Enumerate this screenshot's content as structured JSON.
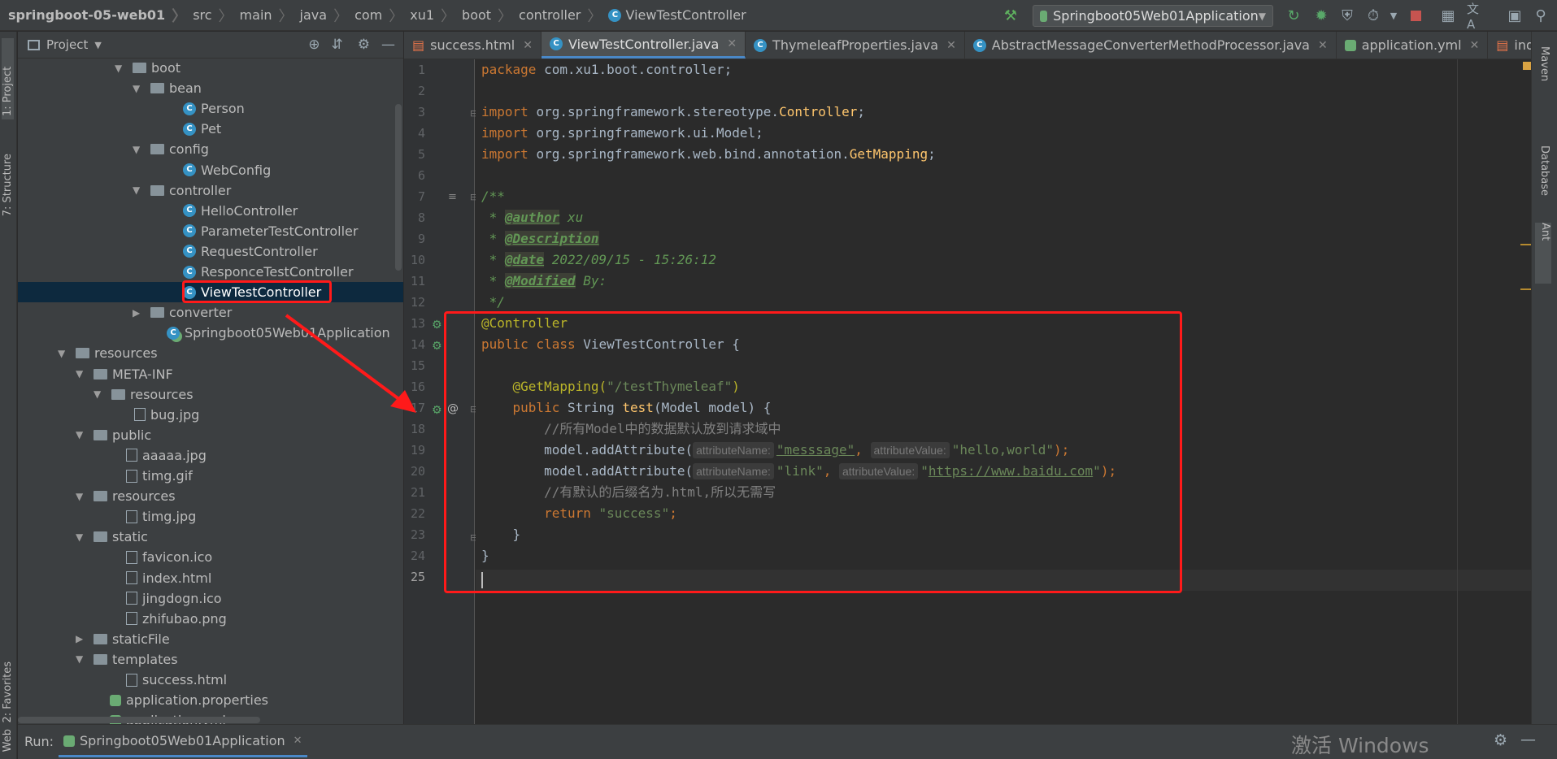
{
  "breadcrumb": [
    "springboot-05-web01",
    "src",
    "main",
    "java",
    "com",
    "xu1",
    "boot",
    "controller",
    "ViewTestController"
  ],
  "toolbar": {
    "run_config": "Springboot05Web01Application"
  },
  "left_strip": {
    "project_label": "1: Project",
    "structure_label": "7: Structure",
    "favorites_label": "2: Favorites",
    "web_label": "Web"
  },
  "project_panel": {
    "title": "Project",
    "tree": [
      {
        "label": "boot",
        "kind": "folder",
        "expanded": true
      },
      {
        "label": "bean",
        "kind": "folder",
        "expanded": true
      },
      {
        "label": "Person",
        "kind": "class"
      },
      {
        "label": "Pet",
        "kind": "class"
      },
      {
        "label": "config",
        "kind": "folder",
        "expanded": true
      },
      {
        "label": "WebConfig",
        "kind": "class"
      },
      {
        "label": "controller",
        "kind": "folder",
        "expanded": true
      },
      {
        "label": "HelloController",
        "kind": "class"
      },
      {
        "label": "ParameterTestController",
        "kind": "class"
      },
      {
        "label": "RequestController",
        "kind": "class"
      },
      {
        "label": "ResponceTestController",
        "kind": "class"
      },
      {
        "label": "ViewTestController",
        "kind": "class",
        "selected": true
      },
      {
        "label": "converter",
        "kind": "folder",
        "expanded": false
      },
      {
        "label": "Springboot05Web01Application",
        "kind": "app"
      },
      {
        "label": "resources",
        "kind": "folder",
        "expanded": true
      },
      {
        "label": "META-INF",
        "kind": "folder",
        "expanded": true
      },
      {
        "label": "resources",
        "kind": "folder",
        "expanded": true
      },
      {
        "label": "bug.jpg",
        "kind": "file"
      },
      {
        "label": "public",
        "kind": "folder",
        "expanded": true
      },
      {
        "label": "aaaaa.jpg",
        "kind": "file"
      },
      {
        "label": "timg.gif",
        "kind": "file"
      },
      {
        "label": "resources",
        "kind": "folder",
        "expanded": true
      },
      {
        "label": "timg.jpg",
        "kind": "file"
      },
      {
        "label": "static",
        "kind": "folder",
        "expanded": true
      },
      {
        "label": "favicon.ico",
        "kind": "file"
      },
      {
        "label": "index.html",
        "kind": "file"
      },
      {
        "label": "jingdogn.ico",
        "kind": "file"
      },
      {
        "label": "zhifubao.png",
        "kind": "file"
      },
      {
        "label": "staticFile",
        "kind": "folder",
        "expanded": false
      },
      {
        "label": "templates",
        "kind": "folder",
        "expanded": true
      },
      {
        "label": "success.html",
        "kind": "file"
      },
      {
        "label": "application.properties",
        "kind": "config"
      },
      {
        "label": "application.yml",
        "kind": "config"
      }
    ]
  },
  "tabs": [
    {
      "label": "success.html",
      "active": false
    },
    {
      "label": "ViewTestController.java",
      "active": true
    },
    {
      "label": "ThymeleafProperties.java",
      "active": false
    },
    {
      "label": "AbstractMessageConverterMethodProcessor.java",
      "active": false
    },
    {
      "label": "application.yml",
      "active": false
    },
    {
      "label": "index.html",
      "active": false
    }
  ],
  "right_strip": {
    "maven_label": "Maven",
    "database_label": "Database",
    "ant_label": "Ant"
  },
  "editor": {
    "line_numbers": [
      "1",
      "2",
      "3",
      "4",
      "5",
      "6",
      "7",
      "8",
      "9",
      "10",
      "11",
      "12",
      "13",
      "14",
      "15",
      "16",
      "17",
      "18",
      "19",
      "20",
      "21",
      "22",
      "23",
      "24",
      "25"
    ],
    "code": {
      "l1_kw": "package ",
      "l1_rest": "com.xu1.boot.controller;",
      "l3_kw": "import ",
      "l3_pkg": "org.springframework.stereotype.",
      "l3_cls": "Controller",
      "l4_kw": "import ",
      "l4_pkg": "org.springframework.ui.Model;",
      "l5_kw": "import ",
      "l5_pkg": "org.springframework.web.bind.annotation.",
      "l5_cls": "GetMapping",
      "semi": ";",
      "l7": "/**",
      "l8_star": " * ",
      "l8_tag": "@author",
      "l8_val": " xu",
      "l9_star": " * ",
      "l9_tag": "@Description",
      "l10_star": " * ",
      "l10_tag": "@date",
      "l10_val": " 2022/09/15 - 15:26:12",
      "l11_star": " * ",
      "l11_tag": "@Modified",
      "l11_val": " By:",
      "l12": " */",
      "l13": "@Controller",
      "l14_kw": "public class ",
      "l14_rest": "ViewTestController {",
      "l16_ann": "    @GetMapping(",
      "l16_str": "\"/testThymeleaf\"",
      "l16_end": ")",
      "l17_kw": "    public ",
      "l17_type": "String ",
      "l17_fn": "test",
      "l17_rest": "(Model model) {",
      "l18": "        //所有Model中的数据默认放到请求域中",
      "l19_pre": "        model.addAttribute(",
      "l19_hint1": "attributeName:",
      "l19_str1": "\"messsage\"",
      "l19_comma": ", ",
      "l19_hint2": "attributeValue:",
      "l19_str2": "\"hello,world\"",
      "l19_end": ");",
      "l20_pre": "        model.addAttribute(",
      "l20_hint1": "attributeName:",
      "l20_str1": "\"link\"",
      "l20_comma": ", ",
      "l20_hint2": "attributeValue:",
      "l20_q": "\"",
      "l20_url": "https://www.baidu.com",
      "l20_end": ");",
      "l21": "        //有默认的后缀名为.html,所以无需写",
      "l22_kw": "        return ",
      "l22_str": "\"success\"",
      "l23": "    }",
      "l24": "}"
    }
  },
  "run_bar": {
    "run_label": "Run:",
    "run_tab": "Springboot05Web01Application"
  },
  "watermark": "激活 Windows",
  "colors": {
    "annotation_red": "#ff1a1a",
    "selection": "#0d293e",
    "accent": "#4a88c7"
  }
}
